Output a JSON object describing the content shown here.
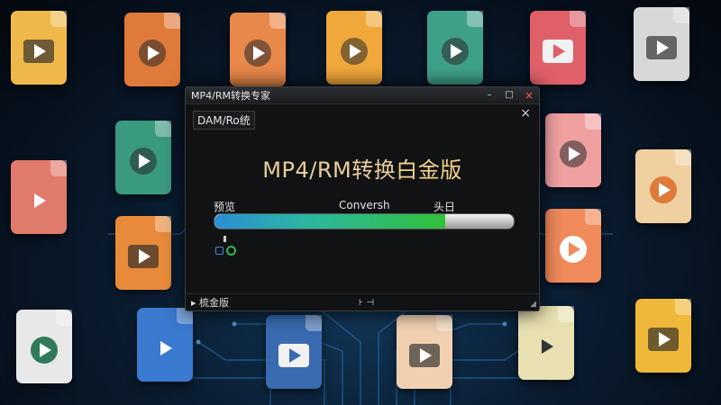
{
  "window": {
    "title": "MP4/RM转换专家",
    "minimize": "–",
    "maximize": "□",
    "close": "×"
  },
  "toolbar": {
    "menu_label": "DAM/Ro统",
    "close": "×"
  },
  "main": {
    "headline_part1": "MP4/RM转换",
    "headline_part2": "白金版"
  },
  "progress": {
    "left_label": "预览",
    "middle_label": "Conversh",
    "right_label": "头日",
    "fill_fraction": 0.77
  },
  "footer": {
    "left_text": "▸ 梳金版",
    "middle_text": "⊦ ⊣",
    "grip": "◢"
  },
  "colors": {
    "headline": "#e7cf9c",
    "progress_green": "#31c13a",
    "progress_blue": "#2b8fd6",
    "close_red": "#ff5a4a"
  },
  "background_icons": [
    {
      "name": "video-file-icon",
      "color": "#f0b84a"
    },
    {
      "name": "video-file-icon",
      "color": "#e07a3a"
    },
    {
      "name": "video-file-icon",
      "color": "#e8884a"
    },
    {
      "name": "video-file-icon",
      "color": "#f0a83a"
    },
    {
      "name": "video-file-icon",
      "color": "#3fa08a"
    },
    {
      "name": "video-file-icon",
      "color": "#e0606a"
    },
    {
      "name": "video-file-icon",
      "color": "#d8d8d8"
    },
    {
      "name": "video-file-icon",
      "color": "#3a9a80"
    },
    {
      "name": "video-file-icon",
      "color": "#e07a6a"
    },
    {
      "name": "video-file-icon",
      "color": "#e88a3a"
    },
    {
      "name": "video-file-icon",
      "color": "#f0a0a0"
    },
    {
      "name": "video-file-icon",
      "color": "#f0d0a0"
    },
    {
      "name": "video-file-icon",
      "color": "#f08a5a"
    },
    {
      "name": "video-file-icon",
      "color": "#e8e8e8"
    },
    {
      "name": "video-file-icon",
      "color": "#3a7ad0"
    },
    {
      "name": "video-file-icon",
      "color": "#3a6ab0"
    },
    {
      "name": "video-file-icon",
      "color": "#f0d0b0"
    },
    {
      "name": "video-file-icon",
      "color": "#f0c0a0"
    },
    {
      "name": "video-file-icon",
      "color": "#e8e0b0"
    },
    {
      "name": "video-file-icon",
      "color": "#f0b83a"
    }
  ]
}
